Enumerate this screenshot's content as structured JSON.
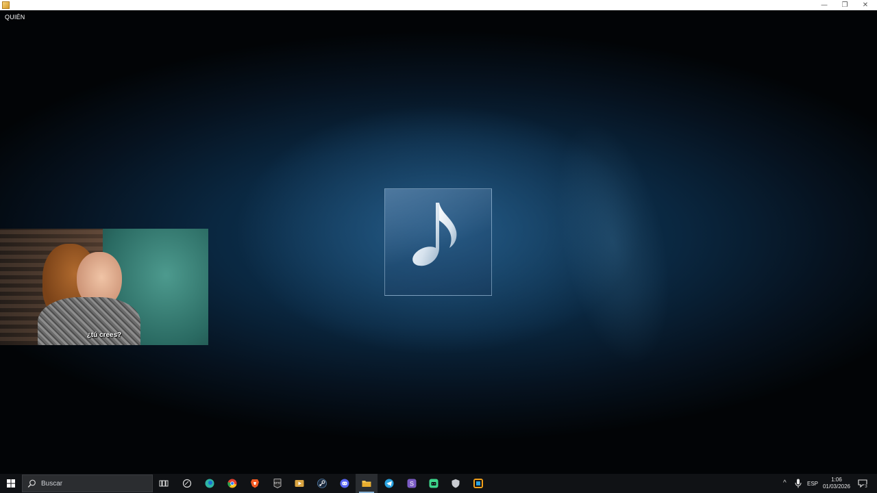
{
  "window": {
    "minimize_glyph": "—",
    "maximize_glyph": "❐",
    "close_glyph": "✕"
  },
  "player": {
    "track_title": "QUIÉN",
    "artwork_icon": "music-note-icon"
  },
  "video_panel": {
    "subtitle": "¿tú crees?"
  },
  "taskbar": {
    "search_placeholder": "Buscar",
    "apps": [
      {
        "name": "task-view",
        "icon": "task-view-icon"
      },
      {
        "name": "cortana",
        "icon": "cortana-icon"
      },
      {
        "name": "edge",
        "icon": "edge-icon",
        "color": "#2fb4a2"
      },
      {
        "name": "chrome",
        "icon": "chrome-icon",
        "color": "#e5402f"
      },
      {
        "name": "brave",
        "icon": "brave-icon",
        "color": "#f25a22"
      },
      {
        "name": "epic-games",
        "icon": "epic-games-icon",
        "label": "EPIC"
      },
      {
        "name": "media-player",
        "icon": "media-player-icon",
        "color": "#d9a441"
      },
      {
        "name": "steam",
        "icon": "steam-icon",
        "color": "#1b2a3d"
      },
      {
        "name": "discord",
        "icon": "discord-icon",
        "color": "#5865f2"
      },
      {
        "name": "file-explorer",
        "icon": "folder-icon",
        "color": "#f2c14e"
      },
      {
        "name": "telegram",
        "icon": "telegram-icon",
        "color": "#2aa3e0"
      },
      {
        "name": "app-s",
        "icon": "s-app-icon",
        "color": "#7a5bc4"
      },
      {
        "name": "app-green",
        "icon": "android-app-icon",
        "color": "#3dd68c"
      },
      {
        "name": "vpn",
        "icon": "shield-icon",
        "color": "#c9ccd1"
      },
      {
        "name": "app-orange",
        "icon": "window-app-icon",
        "color": "#f3a11b"
      }
    ],
    "tray": {
      "chevron": "^",
      "language": "ESP",
      "time": "1:06",
      "date": "01/03/2026",
      "notification_count": "3"
    }
  }
}
